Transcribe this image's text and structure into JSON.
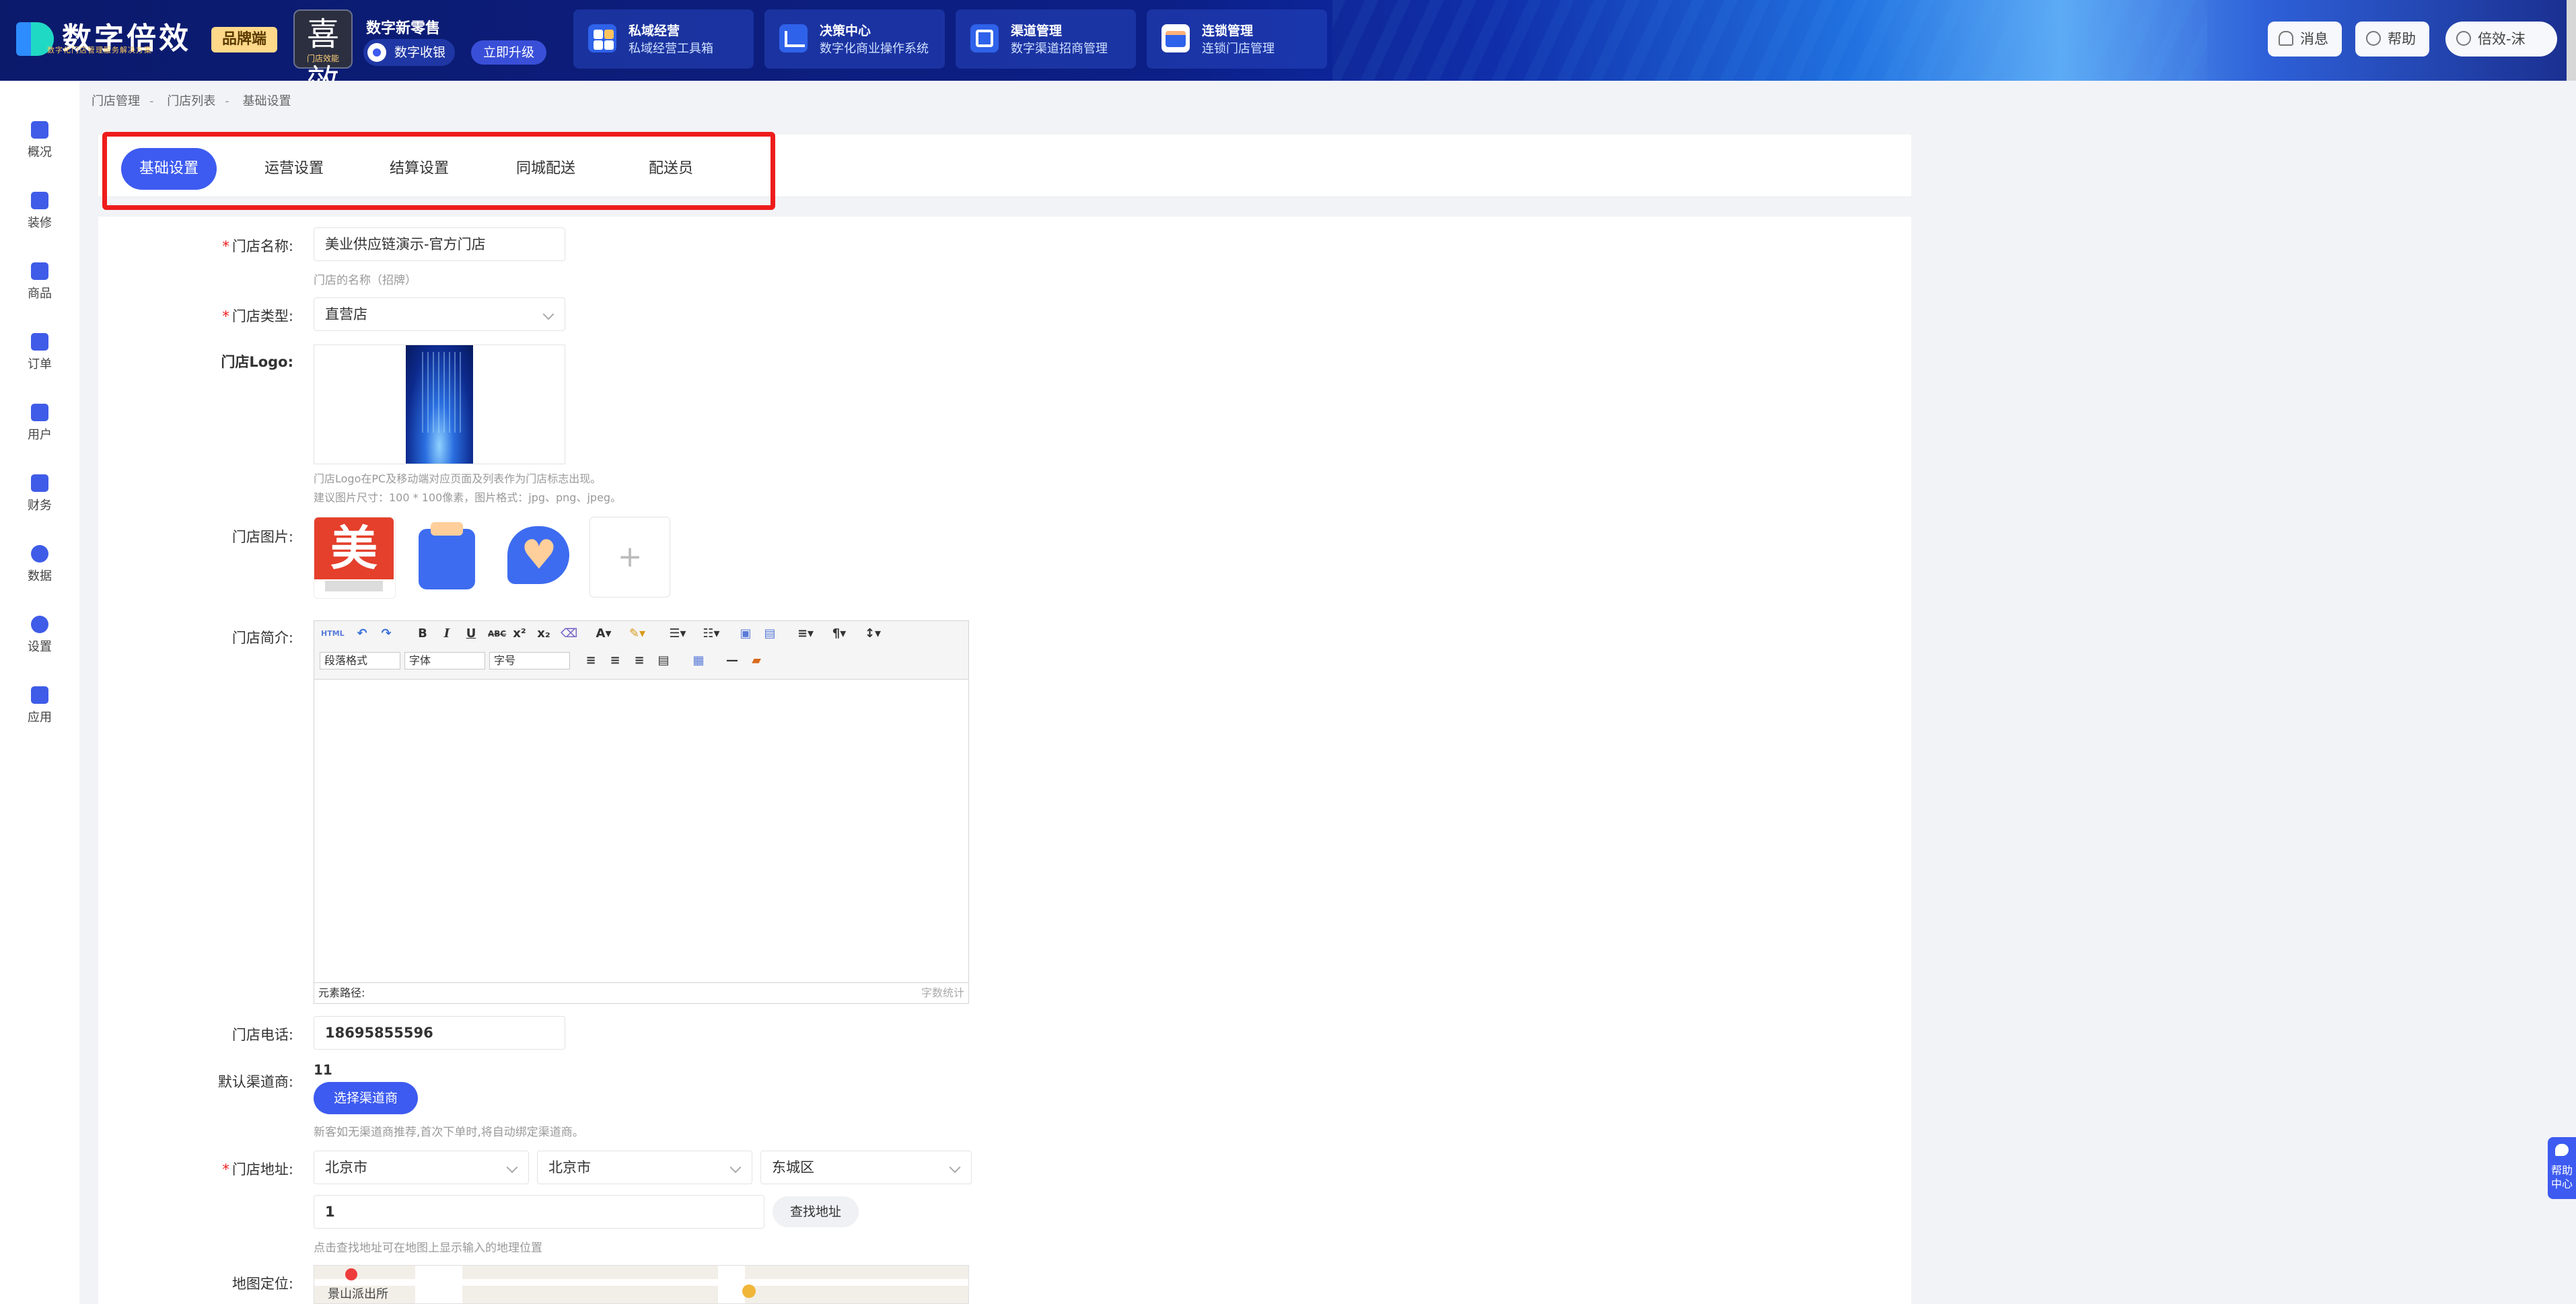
{
  "topbar": {
    "logo_text": "数字倍效",
    "logo_sub": "数字化门店管理服务解决方案",
    "brand_tag": "品牌端",
    "app_box_char": "喜效",
    "app_box_sub": "门店效能",
    "app_name": "数字新零售",
    "app_pill": "数字收银",
    "upgrade": "立即升级",
    "nav_cards": [
      {
        "title": "私域经营",
        "sub": "私域经营工具箱",
        "icon": "grid-icon"
      },
      {
        "title": "决策中心",
        "sub": "数字化商业操作系统",
        "icon": "chart-line-icon"
      },
      {
        "title": "渠道管理",
        "sub": "数字渠道招商管理",
        "icon": "channel-icon"
      },
      {
        "title": "连锁管理",
        "sub": "连锁门店管理",
        "icon": "store-icon"
      }
    ],
    "message": "消息",
    "help": "帮助",
    "user": "倍效-沫"
  },
  "leftnav": [
    {
      "label": "概况",
      "icon": "overview-icon"
    },
    {
      "label": "装修",
      "icon": "decorate-icon"
    },
    {
      "label": "商品",
      "icon": "product-icon"
    },
    {
      "label": "订单",
      "icon": "order-icon"
    },
    {
      "label": "用户",
      "icon": "user-icon"
    },
    {
      "label": "财务",
      "icon": "finance-icon"
    },
    {
      "label": "数据",
      "icon": "data-pie-icon"
    },
    {
      "label": "设置",
      "icon": "settings-icon"
    },
    {
      "label": "应用",
      "icon": "apps-icon"
    }
  ],
  "breadcrumb": [
    "门店管理",
    "门店列表",
    "基础设置"
  ],
  "tabs": [
    "基础设置",
    "运营设置",
    "结算设置",
    "同城配送",
    "配送员"
  ],
  "form": {
    "name_label": "门店名称:",
    "name_value": "美业供应链演示-官方门店",
    "name_hint": "门店的名称（招牌）",
    "type_label": "门店类型:",
    "type_value": "直营店",
    "logo_label": "门店Logo:",
    "logo_hint1": "门店Logo在PC及移动端对应页面及列表作为门店标志出现。",
    "logo_hint2": "建议图片尺寸：100 * 100像素，图片格式：jpg、png、jpeg。",
    "images_label": "门店图片:",
    "add_symbol": "+",
    "intro_label": "门店简介:",
    "editor": {
      "paragraph_format": "段落格式",
      "font": "字体",
      "font_size": "字号",
      "footer_path": "元素路径:",
      "footer_count": "字数统计"
    },
    "phone_label": "门店电话:",
    "phone_value": "18695855596",
    "channel_label": "默认渠道商:",
    "channel_value": "11",
    "channel_button": "选择渠道商",
    "channel_hint": "新客如无渠道商推荐,首次下单时,将自动绑定渠道商。",
    "address_label": "门店地址:",
    "province": "北京市",
    "city": "北京市",
    "district": "东城区",
    "address_value": "1",
    "find_address": "查找地址",
    "address_hint": "点击查找地址可在地图上显示输入的地理位置",
    "map_label": "地图定位:",
    "map_poi": "景山派出所"
  },
  "help_float": "帮助中心",
  "colors": {
    "primary": "#3d5bf0",
    "highlight": "#ee1c1c",
    "required": "#ee1c1c"
  }
}
